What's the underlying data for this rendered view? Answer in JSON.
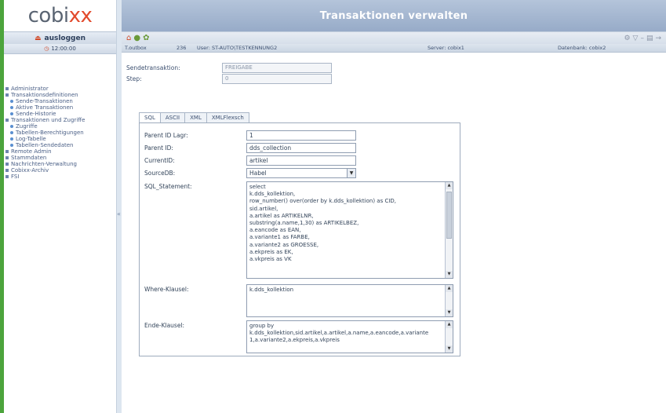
{
  "logo": {
    "part1": "cobi",
    "part2": "xx"
  },
  "sidebar": {
    "logout_label": "ausloggen",
    "time": "12:00:00",
    "items": [
      {
        "label": "Administrator",
        "level": 0
      },
      {
        "label": "Transaktionsdefinitionen",
        "level": 0
      },
      {
        "label": "Sende-Transaktionen",
        "level": 1
      },
      {
        "label": "Aktive Transaktionen",
        "level": 1
      },
      {
        "label": "Sende-Historie",
        "level": 1
      },
      {
        "label": "Transaktionen und Zugriffe",
        "level": 0
      },
      {
        "label": "Zugriffe",
        "level": 1
      },
      {
        "label": "Tabellen-Berechtigungen",
        "level": 1
      },
      {
        "label": "Log-Tabelle",
        "level": 1
      },
      {
        "label": "Tabellen-Sendedaten",
        "level": 1
      },
      {
        "label": "Remote Admin",
        "level": 0
      },
      {
        "label": "Stammdaten",
        "level": 0
      },
      {
        "label": "Nachrichten-Verwaltung",
        "level": 0
      },
      {
        "label": "Cobixx-Archiv",
        "level": 0
      },
      {
        "label": "FSI",
        "level": 0
      }
    ]
  },
  "header": {
    "title": "Transaktionen verwalten"
  },
  "infobar": {
    "module": "T.outbox",
    "id": "236",
    "user": "User: ST-AUTO\\TESTKENNUNG2",
    "server": "Server: cobix1",
    "database": "Datenbank: cobix2"
  },
  "form": {
    "send_transaction_label": "Sendetransaktion:",
    "send_transaction_value": "FREIGABE",
    "step_label": "Step:",
    "step_value": "0"
  },
  "tabs": [
    "SQL",
    "ASCII",
    "XML",
    "XMLFlexsch"
  ],
  "panel": {
    "parent_id_label": "Parent ID Lagr:",
    "parent_id_value": "1",
    "parent_id2_label": "Parent ID:",
    "parent_id2_value": "dds_collection",
    "current_id_label": "CurrentID:",
    "current_id_value": "artikel",
    "source_db_label": "SourceDB:",
    "source_db_value": "Habel",
    "sql_label": "SQL_Statement:",
    "sql_lines": [
      "select",
      "k.dds_kollektion,",
      "row_number() over(order by k.dds_kollektion) as CID,",
      "sid.artikel,",
      "a.artikel as ARTIKELNR,",
      "substring(a.name,1,30) as ARTIKELBEZ,",
      "a.eancode as EAN,",
      "a.variante1 as FARBE,",
      "a.variante2 as GROESSE,",
      "a.ekpreis as EK,",
      "a.vkpreis as VK"
    ],
    "where_label": "Where-Klausel:",
    "where_lines": [
      "k.dds_kollektion"
    ],
    "group_label": "Ende-Klausel:",
    "group_lines": [
      "group by",
      "k.dds_kollektion,sid.artikel,a.artikel,a.name,a.eancode,a.variante",
      "1,a.variante2,a.ekpreis,a.vkpreis"
    ]
  }
}
